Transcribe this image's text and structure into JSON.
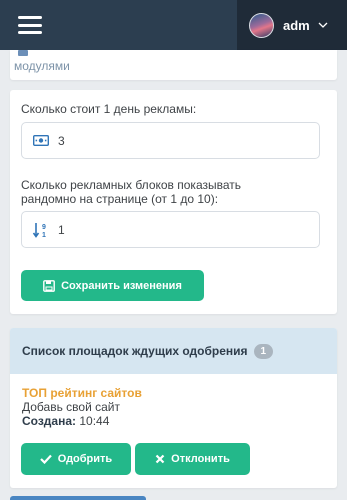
{
  "topbar": {
    "menu_icon": "hamburger-icon",
    "user_name": "adm",
    "dropdown_icon": "chevron-down-icon"
  },
  "top_card": {
    "partial_text": "модулями"
  },
  "settings": {
    "price_label": "Сколько стоит 1 день рекламы:",
    "price_icon": "money-icon",
    "price_value": "3",
    "blocks_label_line1": "Сколько рекламных блоков показывать",
    "blocks_label_line2": "рандомно на странице (от 1 до 10):",
    "blocks_icon": "sort-numeric-icon",
    "blocks_value": "1",
    "save_label": "Сохранить изменения"
  },
  "approval": {
    "title": "Список площадок ждущих одобрения",
    "count": "1",
    "item": {
      "name": "ТОП рейтинг сайтов",
      "description": "Добавь свой сайт",
      "created_label": "Создана:",
      "created_time": "10:44"
    },
    "approve_label": "Одобрить",
    "reject_label": "Отклонить"
  },
  "colors": {
    "topbar": "#2c3e50",
    "accent_green": "#23b88a",
    "site_link": "#e8a135",
    "panel_header": "#d6e6f1"
  }
}
